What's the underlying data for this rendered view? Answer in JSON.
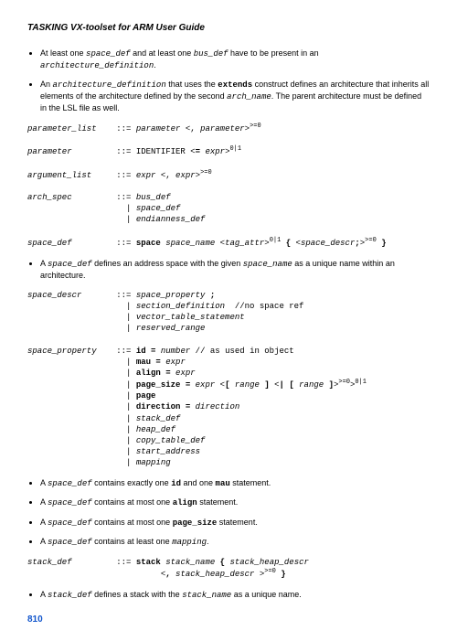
{
  "header": "TASKING VX-toolset for ARM User Guide",
  "b1_pre": "At least one ",
  "b1_c1": "space_def",
  "b1_mid": " and at least one ",
  "b1_c2": "bus_def",
  "b1_post": " have to be present in an ",
  "b1_c3": "architecture_definition",
  "b1_end": ".",
  "b2_pre": "An ",
  "b2_c1": "architecture_definition",
  "b2_mid1": " that uses the ",
  "b2_kw": "extends",
  "b2_mid2": " construct defines an architecture that inherits all elements of the architecture defined by the second ",
  "b2_c2": "arch_name",
  "b2_end": ". The parent architecture must be defined in the LSL file as well.",
  "g1": "parameter_list    ::= parameter <, parameter>>=0\n\nparameter         ::= IDENTIFIER <= expr>0|1\n\nargument_list     ::= expr <, expr>>=0\n\narch_spec         ::= bus_def\n                    | space_def\n                    | endianness_def\n\nspace_def         ::= space space_name <tag_attr>0|1 { <space_descr;>>=0 }",
  "g1_html": "<span class=\"gi\">parameter_list</span>    ::= <span class=\"gi\">parameter</span> &lt;, <span class=\"gi\">parameter</span>&gt;<sup>&gt;=0</sup>\n\n<span class=\"gi\">parameter</span>         ::= IDENTIFIER &lt;<span class=\"gb\">=</span> <span class=\"gi\">expr</span>&gt;<sup>0|1</sup>\n\n<span class=\"gi\">argument_list</span>     ::= <span class=\"gi\">expr</span> &lt;, <span class=\"gi\">expr</span>&gt;<sup>&gt;=0</sup>\n\n<span class=\"gi\">arch_spec</span>         ::= <span class=\"gi\">bus_def</span>\n                    | <span class=\"gi\">space_def</span>\n                    | <span class=\"gi\">endianness_def</span>\n\n<span class=\"gi\">space_def</span>         ::= <span class=\"gb\">space</span> <span class=\"gi\">space_name</span> &lt;<span class=\"gi\">tag_attr</span>&gt;<sup>0|1</sup> <span class=\"gb\">{</span> &lt;<span class=\"gi\">space_descr</span><span class=\"gb\">;</span>&gt;<sup>&gt;=0</sup> <span class=\"gb\">}</span>",
  "b3_pre": "A ",
  "b3_c1": "space_def",
  "b3_mid": " defines an address space with the given ",
  "b3_c2": "space_name",
  "b3_end": " as a unique name within an architecture.",
  "g2_html": "<span class=\"gi\">space_descr</span>       ::= <span class=\"gi\">space_property</span> <span class=\"gb\">;</span>\n                    | <span class=\"gi\">section_definition</span>  //no space ref\n                    | <span class=\"gi\">vector_table_statement</span>\n                    | <span class=\"gi\">reserved_range</span>\n\n<span class=\"gi\">space_property</span>    ::= <span class=\"gb\">id =</span> <span class=\"gi\">number</span> // as used in object\n                    | <span class=\"gb\">mau =</span> <span class=\"gi\">expr</span>\n                    | <span class=\"gb\">align =</span> <span class=\"gi\">expr</span>\n                    | <span class=\"gb\">page_size =</span> <span class=\"gi\">expr</span> &lt;<span class=\"gb\">[</span> <span class=\"gi\">range</span> <span class=\"gb\">]</span> &lt;<span class=\"gb\">|</span> <span class=\"gb\">[</span> <span class=\"gi\">range</span> <span class=\"gb\">]</span>&gt;<sup>&gt;=0</sup>&gt;<sup>0|1</sup>\n                    | <span class=\"gb\">page</span>\n                    | <span class=\"gb\">direction =</span> <span class=\"gi\">direction</span>\n                    | <span class=\"gi\">stack_def</span>\n                    | <span class=\"gi\">heap_def</span>\n                    | <span class=\"gi\">copy_table_def</span>\n                    | <span class=\"gi\">start_address</span>\n                    | <span class=\"gi\">mapping</span>",
  "b4_pre": "A ",
  "b4_c": "space_def",
  "b4_mid": " contains exactly one ",
  "b4_k1": "id",
  "b4_and": " and one ",
  "b4_k2": "mau",
  "b4_end": " statement.",
  "b5_pre": "A ",
  "b5_c": "space_def",
  "b5_mid": " contains at most one ",
  "b5_k": "align",
  "b5_end": " statement.",
  "b6_pre": "A ",
  "b6_c": "space_def",
  "b6_mid": " contains at most one ",
  "b6_k": "page_size",
  "b6_end": " statement.",
  "b7_pre": "A ",
  "b7_c": "space_def",
  "b7_mid": " contains at least one ",
  "b7_ci": "mapping",
  "b7_end": ".",
  "g3_html": "<span class=\"gi\">stack_def</span>         ::= <span class=\"gb\">stack</span> <span class=\"gi\">stack_name</span> <span class=\"gb\">{</span> <span class=\"gi\">stack_heap_descr</span>\n                           &lt;<span class=\"gb\">,</span> <span class=\"gi\">stack_heap_descr</span> &gt;<sup>&gt;=0</sup> <span class=\"gb\">}</span>",
  "b8_pre": "A ",
  "b8_c1": "stack_def",
  "b8_mid": " defines a stack with the ",
  "b8_c2": "stack_name",
  "b8_end": " as a unique name.",
  "pagenum": "810"
}
